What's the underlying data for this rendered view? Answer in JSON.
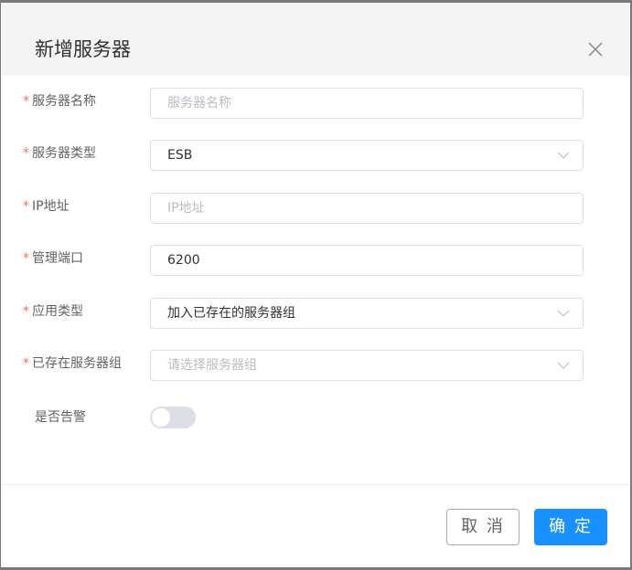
{
  "dialog": {
    "title": "新增服务器",
    "close_icon": "close-icon"
  },
  "form": {
    "required_mark": "*",
    "server_name": {
      "label": "服务器名称",
      "placeholder": "服务器名称",
      "value": ""
    },
    "server_type": {
      "label": "服务器类型",
      "value": "ESB"
    },
    "ip_address": {
      "label": "IP地址",
      "placeholder": "IP地址",
      "value": ""
    },
    "manage_port": {
      "label": "管理端口",
      "value": "6200"
    },
    "app_type": {
      "label": "应用类型",
      "value": "加入已存在的服务器组"
    },
    "existing_group": {
      "label": "已存在服务器组",
      "placeholder": "请选择服务器组"
    },
    "alarm": {
      "label": "是否告警",
      "enabled": false
    }
  },
  "footer": {
    "cancel_label": "取 消",
    "confirm_label": "确 定"
  },
  "colors": {
    "primary": "#1890ff",
    "required": "#f56c6c",
    "overlay": "#7a7a7a"
  }
}
